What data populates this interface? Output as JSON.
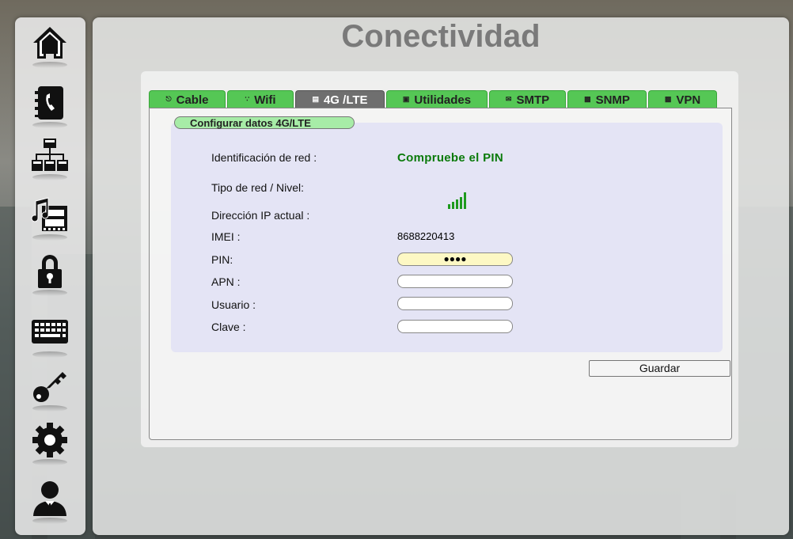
{
  "page": {
    "title": "Conectividad"
  },
  "sidebar": {
    "items": [
      {
        "icon": "home-icon"
      },
      {
        "icon": "phonebook-icon"
      },
      {
        "icon": "network-icon"
      },
      {
        "icon": "media-icon"
      },
      {
        "icon": "lock-icon"
      },
      {
        "icon": "keyboard-icon"
      },
      {
        "icon": "key-icon"
      },
      {
        "icon": "gear-icon"
      },
      {
        "icon": "user-icon"
      }
    ]
  },
  "tabs": [
    {
      "label": "Cable",
      "icon": "ethernet-icon"
    },
    {
      "label": "Wifi",
      "icon": "wifi-icon"
    },
    {
      "label": "4G /LTE",
      "icon": "cellular-icon",
      "active": true
    },
    {
      "label": "Utilidades",
      "icon": "tools-icon"
    },
    {
      "label": "SMTP",
      "icon": "mail-icon"
    },
    {
      "label": "SNMP",
      "icon": "document-icon"
    },
    {
      "label": "VPN",
      "icon": "document-icon"
    }
  ],
  "section": {
    "title": "Configurar datos 4G/LTE"
  },
  "form": {
    "network_id_label": "Identificación de red :",
    "network_id_value": "Compruebe el PIN",
    "network_type_label": "Tipo de red / Nivel:",
    "signal_level": 5,
    "ip_label": "Dirección IP actual :",
    "ip_value": "",
    "imei_label": "IMEI :",
    "imei_value": "8688220413",
    "pin_label": "PIN:",
    "pin_value": "●●●●",
    "apn_label": "APN :",
    "apn_value": "",
    "user_label": "Usuario :",
    "user_value": "",
    "password_label": "Clave :",
    "password_value": ""
  },
  "actions": {
    "save_label": "Guardar"
  },
  "colors": {
    "tab_green": "#55c755",
    "tab_active": "#6f6f6f",
    "status_green": "#0a7a0a",
    "pin_field": "#fdf8c4"
  }
}
